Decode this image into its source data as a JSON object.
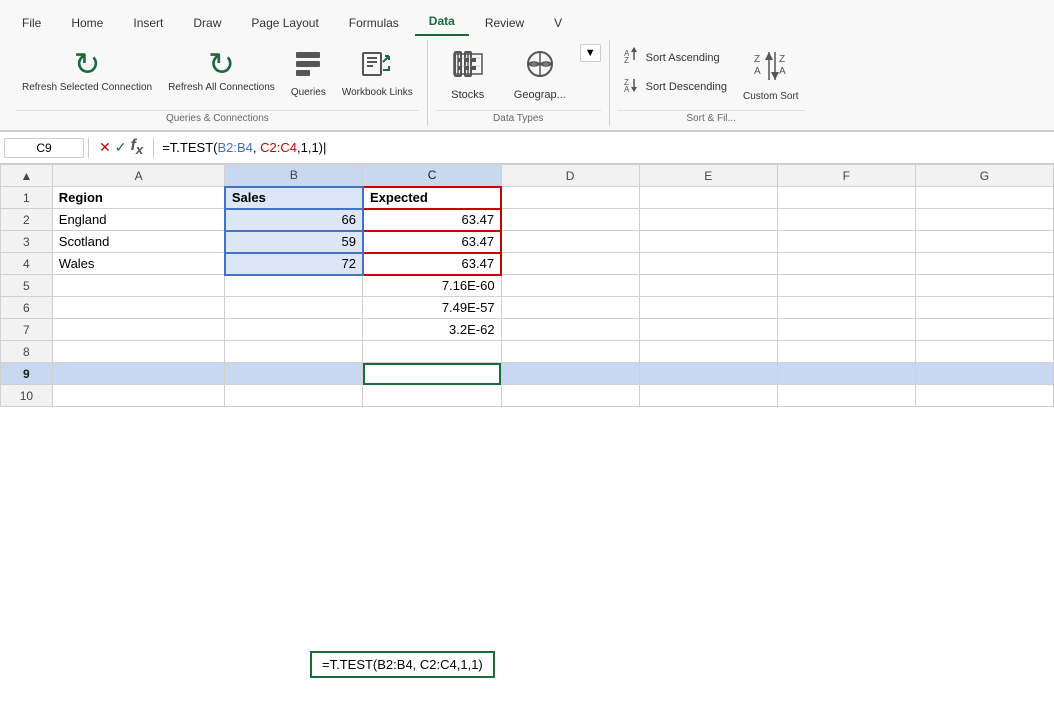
{
  "tabs": [
    {
      "label": "File",
      "active": false
    },
    {
      "label": "Home",
      "active": false
    },
    {
      "label": "Insert",
      "active": false
    },
    {
      "label": "Draw",
      "active": false
    },
    {
      "label": "Page Layout",
      "active": false
    },
    {
      "label": "Formulas",
      "active": false
    },
    {
      "label": "Data",
      "active": true
    },
    {
      "label": "Review",
      "active": false
    },
    {
      "label": "V",
      "active": false
    }
  ],
  "ribbon": {
    "groups": [
      {
        "label": "Queries & Connections",
        "buttons": [
          {
            "id": "refresh-selected",
            "label": "Refresh Selected\nConnection",
            "icon": "↻"
          },
          {
            "id": "refresh-all",
            "label": "Refresh All\nConnections",
            "icon": "↻"
          },
          {
            "id": "queries",
            "label": "Queries",
            "icon": "≡"
          },
          {
            "id": "workbook-links",
            "label": "Workbook\nLinks",
            "icon": "⬡"
          }
        ]
      },
      {
        "label": "Data Types",
        "buttons": [
          {
            "id": "stocks",
            "label": "Stocks",
            "icon": "🏛"
          },
          {
            "id": "geography",
            "label": "Geograp...",
            "icon": "🗺"
          }
        ]
      },
      {
        "label": "Sort & Filter",
        "buttons": [
          {
            "id": "sort-ascending",
            "label": "Sort Ascending",
            "icon": "↑"
          },
          {
            "id": "sort-descending",
            "label": "Sort Descending",
            "icon": "↓"
          },
          {
            "id": "custom-sort",
            "label": "Custom\nSort",
            "icon": "ZA"
          }
        ]
      }
    ]
  },
  "formula_bar": {
    "cell_ref": "C9",
    "formula_prefix": "=T.TEST(",
    "formula_b_part": "B2:B4",
    "formula_separator": ", ",
    "formula_c_part": "C2:C4",
    "formula_suffix": ",1,1)",
    "formula_full": "=T.TEST(B2:B4, C2:C4,1,1)"
  },
  "columns": [
    "A",
    "B",
    "C",
    "D",
    "E",
    "F",
    "G"
  ],
  "rows": [
    {
      "num": 1,
      "cells": [
        "Region",
        "Sales",
        "Expected",
        "",
        "",
        "",
        ""
      ]
    },
    {
      "num": 2,
      "cells": [
        "England",
        "66",
        "63.47",
        "",
        "",
        "",
        ""
      ]
    },
    {
      "num": 3,
      "cells": [
        "Scotland",
        "59",
        "63.47",
        "",
        "",
        "",
        ""
      ]
    },
    {
      "num": 4,
      "cells": [
        "Wales",
        "72",
        "63.47",
        "",
        "",
        "",
        ""
      ]
    },
    {
      "num": 5,
      "cells": [
        "",
        "",
        "7.16E-60",
        "",
        "",
        "",
        ""
      ]
    },
    {
      "num": 6,
      "cells": [
        "",
        "",
        "7.49E-57",
        "",
        "",
        "",
        ""
      ]
    },
    {
      "num": 7,
      "cells": [
        "",
        "",
        "3.2E-62",
        "",
        "",
        "",
        ""
      ]
    },
    {
      "num": 8,
      "cells": [
        "",
        "",
        "",
        "",
        "",
        "",
        ""
      ]
    },
    {
      "num": 9,
      "cells": [
        "",
        "",
        "",
        "",
        "",
        "",
        ""
      ]
    },
    {
      "num": 10,
      "cells": [
        "",
        "",
        "",
        "",
        "",
        "",
        ""
      ]
    }
  ],
  "formula_tooltip": "=T.TEST(B2:B4, C2:C4,1,1)"
}
